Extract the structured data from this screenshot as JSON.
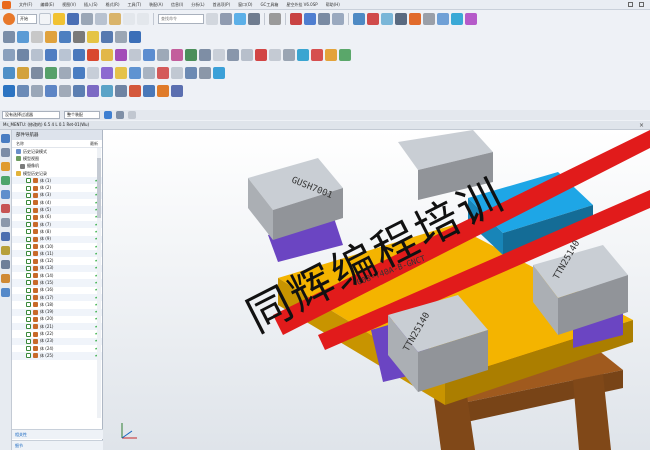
{
  "menubar": {
    "items": [
      "文件(F)",
      "编辑(E)",
      "视图(V)",
      "插入(S)",
      "格式(R)",
      "工具(T)",
      "装配(A)",
      "信息(I)",
      "分析(L)",
      "首选项(P)",
      "窗口(O)",
      "GC工具箱",
      "星空外挂 V6.0SP",
      "帮助(H)"
    ]
  },
  "toolbar": {
    "start_label": "开始",
    "command_finder_placeholder": "查找命令"
  },
  "filterbar": {
    "selection_filter": "没有选择过滤器",
    "assembly_scope": "整个装配"
  },
  "view_tab": {
    "title": "Ms_MENTU: (修改的) 6.5 4 L 0.1 Ret-01(Wu)",
    "close": "×"
  },
  "navigator": {
    "title": "部件导航器",
    "col_name": "名称",
    "col_latest": "最新",
    "nodes": [
      {
        "label": "历史记录模式",
        "icon": "history-icon"
      },
      {
        "label": "模型视图",
        "icon": "view-icon"
      },
      {
        "label": "摄像机",
        "icon": "camera-icon"
      },
      {
        "label": "模型历史记录",
        "icon": "folder-icon"
      }
    ],
    "bodies": [
      "体 (1)",
      "体 (2)",
      "体 (3)",
      "体 (4)",
      "体 (5)",
      "体 (6)",
      "体 (7)",
      "体 (8)",
      "体 (9)",
      "体 (10)",
      "体 (11)",
      "体 (12)",
      "体 (13)",
      "体 (14)",
      "体 (15)",
      "体 (16)",
      "体 (17)",
      "体 (18)",
      "体 (19)",
      "体 (20)",
      "体 (21)",
      "体 (22)",
      "体 (23)",
      "体 (24)",
      "体 (25)"
    ],
    "check_mark": "✔",
    "footer_dependencies": "相关性",
    "footer_details": "细节"
  },
  "model": {
    "plate_label_left": "GUSH7001",
    "plate_label_right": "TTN25140",
    "plate_label_front": "TTN25140",
    "plate_label_center": "008-T40A-B-GNCT"
  },
  "watermark": "同辉编程培训",
  "colors": {
    "base_plate": "#f4b400",
    "rail": "#e11b1b",
    "center_block": "#1ea6e6",
    "clamp": "#c9ced4",
    "shim": "#6b45c2",
    "bottom_base": "#a05a1e",
    "viewport_top": "#ffffff",
    "viewport_bottom": "#dfe4ea"
  }
}
